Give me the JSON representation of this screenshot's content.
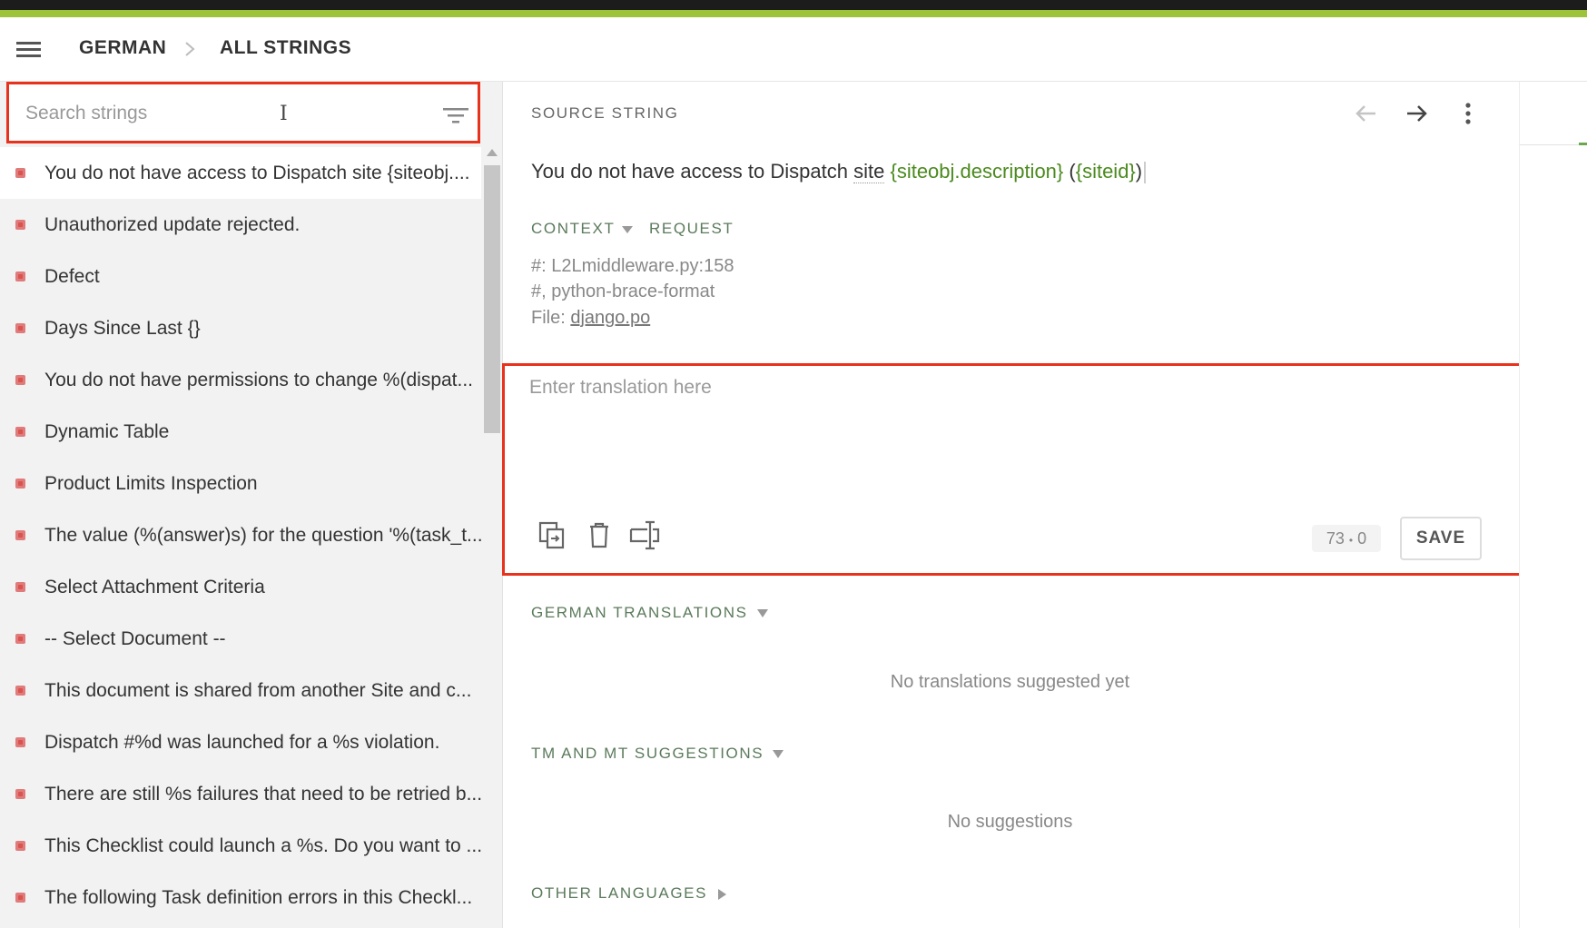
{
  "header": {
    "breadcrumb": [
      "GERMAN",
      "ALL STRINGS"
    ]
  },
  "sidebar": {
    "search_placeholder": "Search strings",
    "strings": [
      "You do not have access to Dispatch site {siteobj....",
      "Unauthorized update rejected.",
      "Defect",
      "Days Since Last {}",
      "You do not have permissions to change %(dispat...",
      "Dynamic Table",
      "Product Limits Inspection",
      "The value (%(answer)s) for the question '%(task_t...",
      "Select Attachment Criteria",
      "-- Select Document --",
      "This document is shared from another Site and c...",
      "Dispatch #%d was launched for a %s violation.",
      "There are still %s failures that need to be retried b...",
      "This Checklist could launch a %s. Do you want to ...",
      "The following Task definition errors in this Checkl..."
    ]
  },
  "source": {
    "label": "SOURCE STRING",
    "text_plain": "You do not have access to Dispatch ",
    "text_dotted": "site",
    "placeholder_1": "{siteobj.description}",
    "paren_open": "(",
    "placeholder_2": "{siteid}",
    "paren_close": ")"
  },
  "context": {
    "tab_context": "CONTEXT",
    "tab_request": "REQUEST",
    "line_1": "#: L2Lmiddleware.py:158",
    "line_2": "#, python-brace-format",
    "file_label": "File: ",
    "file_link": "django.po"
  },
  "editor": {
    "placeholder": "Enter translation here",
    "counter_source": "73",
    "counter_sep": "•",
    "counter_target": "0",
    "save_label": "SAVE"
  },
  "sections": {
    "translations_label": "GERMAN TRANSLATIONS",
    "translations_empty": "No translations suggested yet",
    "suggestions_label": "TM AND MT SUGGESTIONS",
    "suggestions_empty": "No suggestions",
    "other_label": "OTHER LANGUAGES"
  },
  "colors": {
    "accent_green": "#9dc33b",
    "placeholder_green": "#4b8a1e",
    "highlight_red": "#e8321c",
    "status_red": "#d9534f"
  }
}
